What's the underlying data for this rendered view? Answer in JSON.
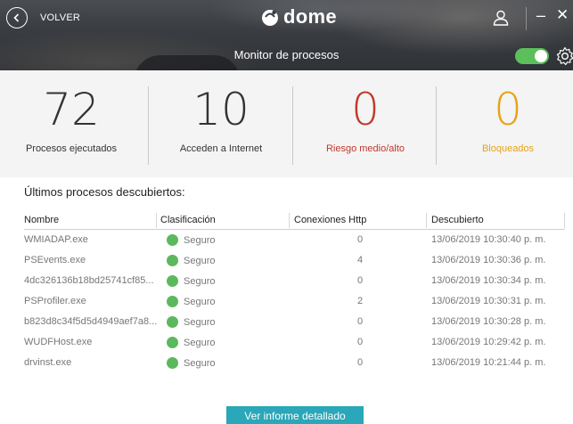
{
  "header": {
    "back_label": "VOLVER",
    "logo_text": "dome",
    "title": "Monitor de procesos",
    "protection_toggle_on": true,
    "accent_color": "#5cbf5c"
  },
  "stats": [
    {
      "value": "72",
      "label": "Procesos ejecutados",
      "color": "#333333"
    },
    {
      "value": "10",
      "label": "Acceden a Internet",
      "color": "#333333"
    },
    {
      "value": "0",
      "label": "Riesgo medio/alto",
      "color": "#c0392b"
    },
    {
      "value": "0",
      "label": "Bloqueados",
      "color": "#e8a317"
    }
  ],
  "processes": {
    "section_title": "Últimos procesos descubiertos:",
    "columns": [
      "Nombre",
      "Clasificación",
      "Conexiones Http",
      "Descubierto"
    ],
    "rows": [
      {
        "name": "WMIADAP.exe",
        "classification": "Seguro",
        "http": "0",
        "discovered": "13/06/2019 10:30:40 p. m."
      },
      {
        "name": "PSEvents.exe",
        "classification": "Seguro",
        "http": "4",
        "discovered": "13/06/2019 10:30:36 p. m."
      },
      {
        "name": "4dc326136b18bd25741cf85...",
        "classification": "Seguro",
        "http": "0",
        "discovered": "13/06/2019 10:30:34 p. m."
      },
      {
        "name": "PSProfiler.exe",
        "classification": "Seguro",
        "http": "2",
        "discovered": "13/06/2019 10:30:31 p. m."
      },
      {
        "name": "b823d8c34f5d5d4949aef7a8...",
        "classification": "Seguro",
        "http": "0",
        "discovered": "13/06/2019 10:30:28 p. m."
      },
      {
        "name": "WUDFHost.exe",
        "classification": "Seguro",
        "http": "0",
        "discovered": "13/06/2019 10:29:42 p. m."
      },
      {
        "name": "drvinst.exe",
        "classification": "Seguro",
        "http": "0",
        "discovered": "13/06/2019 10:21:44 p. m."
      }
    ],
    "safe_color": "#5cb85c"
  },
  "footer": {
    "report_button": "Ver informe detallado"
  }
}
